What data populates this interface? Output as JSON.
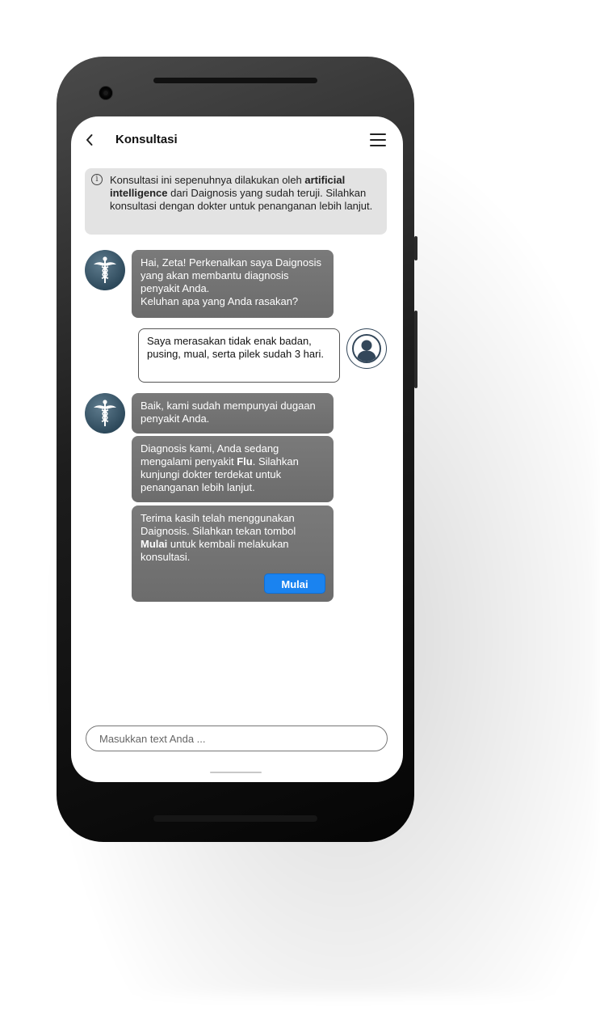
{
  "header": {
    "title": "Konsultasi",
    "back_icon": "chevron-left-icon",
    "menu_icon": "hamburger-menu-icon"
  },
  "info": {
    "icon": "info-icon",
    "text_1": "Konsultasi ini sepenuhnya dilakukan oleh ",
    "bold_1": "artificial intelligence",
    "text_2": " dari Daignosis yang sudah teruji. Silahkan konsultasi dengan dokter untuk penanganan lebih lanjut."
  },
  "messages": {
    "bot_1": {
      "avatar_icon": "caduceus-icon",
      "line_1": "Hai, Zeta! Perkenalkan saya Daignosis yang akan membantu diagnosis penyakit Anda.",
      "line_2": "Keluhan apa yang Anda rasakan?"
    },
    "user_1": {
      "avatar_icon": "user-icon",
      "text": "Saya merasakan tidak enak badan, pusing, mual, serta pilek sudah 3 hari."
    },
    "bot_2": {
      "avatar_icon": "caduceus-icon",
      "text": "Baik, kami sudah mempunyai dugaan penyakit Anda."
    },
    "bot_3": {
      "text_1": "Diagnosis kami, Anda sedang mengalami penyakit ",
      "bold": "Flu",
      "text_2": ". Silahkan kunjungi dokter terdekat untuk penanganan lebih lanjut."
    },
    "bot_4": {
      "text_1": "Terima kasih telah menggunakan Daignosis. Silahkan tekan tombol ",
      "bold": "Mulai",
      "text_2": " untuk kembali melakukan konsultasi.",
      "button_label": "Mulai"
    }
  },
  "input": {
    "placeholder": "Masukkan text Anda ...",
    "value": ""
  },
  "colors": {
    "accent": "#1a83f0",
    "bot_bubble": "#747474",
    "info_background": "#e3e3e3",
    "avatar": "#3a5668"
  }
}
